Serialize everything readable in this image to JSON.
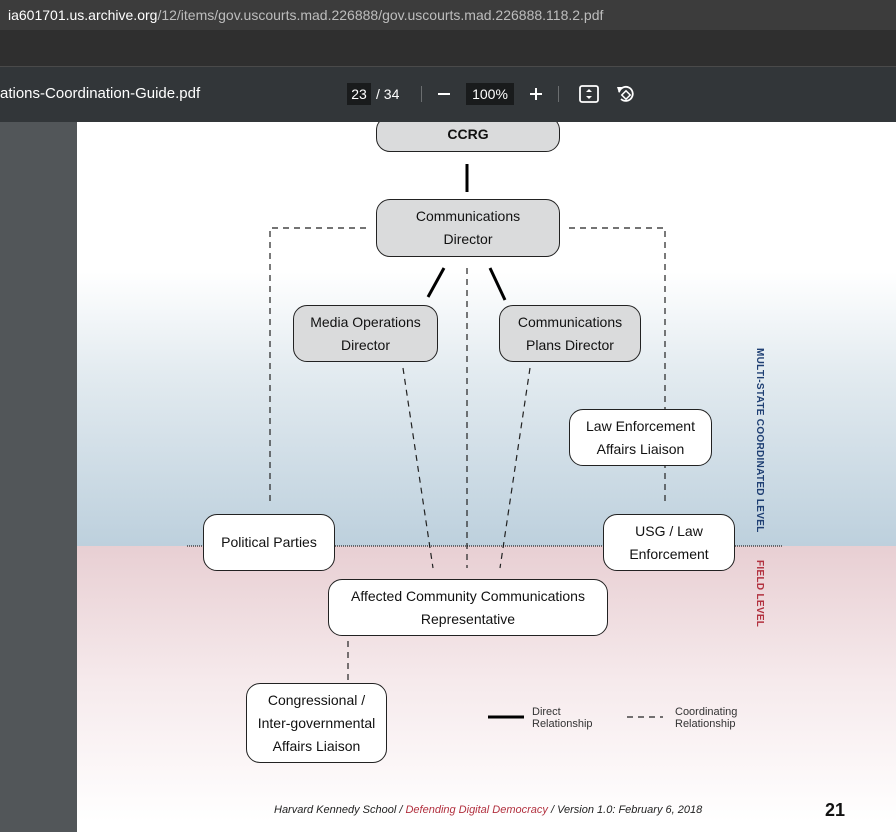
{
  "browser": {
    "url_host": "ia601701.us.archive.org",
    "url_path": "/12/items/gov.uscourts.mad.226888/gov.uscourts.mad.226888.118.2.pdf"
  },
  "toolbar": {
    "file_title": "ations-Coordination-Guide.pdf",
    "current_page": "23",
    "total_pages": "/ 34",
    "zoom": "100%"
  },
  "diagram": {
    "nodes": {
      "ccrg": "CCRG",
      "comm_director_1": "Communications",
      "comm_director_2": "Director",
      "media_ops_1": "Media Operations",
      "media_ops_2": "Director",
      "comm_plans_1": "Communications",
      "comm_plans_2": "Plans Director",
      "law_enf_liaison_1": "Law Enforcement",
      "law_enf_liaison_2": "Affairs Liaison",
      "political_parties": "Political Parties",
      "usg_law_1": "USG / Law",
      "usg_law_2": "Enforcement",
      "affected_1": "Affected Community Communications",
      "affected_2": "Representative",
      "congressional_1": "Congressional /",
      "congressional_2": "Inter-governmental",
      "congressional_3": "Affairs Liaison"
    },
    "levels": {
      "multi_state": "MULTI-STATE COORDINATED LEVEL",
      "field": "FIELD LEVEL"
    },
    "legend": {
      "direct_1": "Direct",
      "direct_2": "Relationship",
      "coord_1": "Coordinating",
      "coord_2": "Relationship"
    },
    "colors": {
      "multi_state_label": "#1f3f73",
      "field_label": "#b2313f",
      "gray_box": "#dadbdc"
    }
  },
  "footer": {
    "org": "Harvard Kennedy School / ",
    "highlight": "Defending Digital Democracy",
    "version": " / Version 1.0: February 6, 2018",
    "page_number": "21"
  }
}
